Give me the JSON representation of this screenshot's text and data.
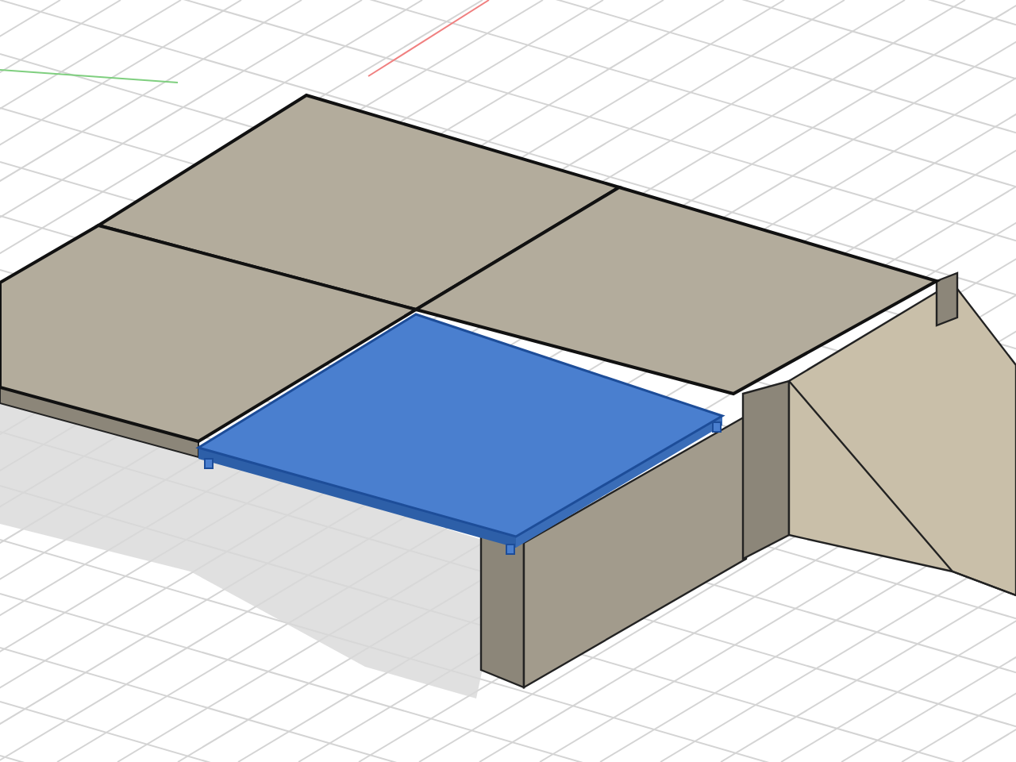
{
  "viewport": {
    "panels": [
      {
        "selected": false
      },
      {
        "selected": false
      },
      {
        "selected": false
      },
      {
        "selected": true
      }
    ]
  }
}
